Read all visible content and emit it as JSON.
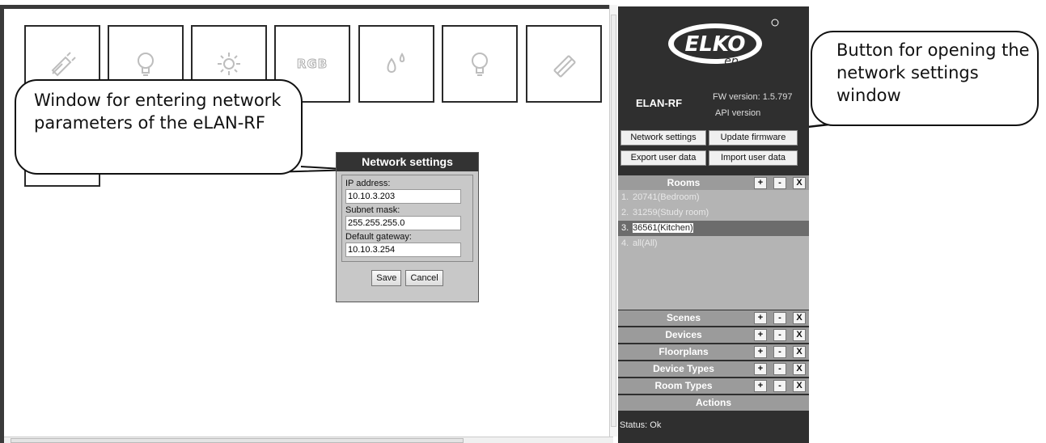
{
  "tiles": [
    {
      "icon": "plug-icon"
    },
    {
      "icon": "bulb-icon"
    },
    {
      "icon": "sun-icon"
    },
    {
      "icon": "rgb-icon",
      "text": "RGB"
    },
    {
      "icon": "drops-icon"
    },
    {
      "icon": "bulb-icon"
    },
    {
      "icon": "heater-icon"
    }
  ],
  "callouts": {
    "left": "Window for entering network parameters of the eLAN-RF",
    "right": "Button for opening the network settings window"
  },
  "network_dialog": {
    "title": "Network settings",
    "ip_label": "IP address:",
    "ip_value": "10.10.3.203",
    "mask_label": "Subnet mask:",
    "mask_value": "255.255.255.0",
    "gateway_label": "Default gateway:",
    "gateway_value": "10.10.3.254",
    "save": "Save",
    "cancel": "Cancel"
  },
  "panel": {
    "logo": "ELKO",
    "logo_sub": "ep",
    "model": "ELAN-RF",
    "fw": "FW version: 1.5.797",
    "api": "API version",
    "buttons": {
      "network": "Network settings",
      "update": "Update firmware",
      "export": "Export user data",
      "import": "Import user data"
    },
    "sections": {
      "rooms": "Rooms",
      "scenes": "Scenes",
      "devices": "Devices",
      "floorplans": "Floorplans",
      "device_types": "Device Types",
      "room_types": "Room Types",
      "actions": "Actions"
    },
    "mini": {
      "add": "+",
      "remove": "-",
      "close": "X"
    },
    "rooms": [
      {
        "num": "1.",
        "name": "20741(Bedroom)"
      },
      {
        "num": "2.",
        "name": "31259(Study room)"
      },
      {
        "num": "3.",
        "name": "36561(Kitchen)"
      },
      {
        "num": "4.",
        "name": "all(All)"
      }
    ],
    "status": "Status: Ok"
  },
  "colors": {
    "panel": "#2f2f2f",
    "section": "#9b9b9b",
    "selected_room": "#6c6c6c"
  }
}
